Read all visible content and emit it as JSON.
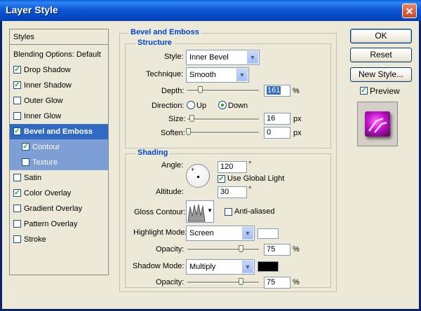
{
  "window": {
    "title": "Layer Style",
    "close_glyph": "✕"
  },
  "styles_list": {
    "header": "Styles",
    "items": [
      {
        "label": "Blending Options: Default",
        "checkbox": false,
        "checked": false
      },
      {
        "label": "Drop Shadow",
        "checkbox": true,
        "checked": true
      },
      {
        "label": "Inner Shadow",
        "checkbox": true,
        "checked": true
      },
      {
        "label": "Outer Glow",
        "checkbox": true,
        "checked": false
      },
      {
        "label": "Inner Glow",
        "checkbox": true,
        "checked": false
      },
      {
        "label": "Bevel and Emboss",
        "checkbox": true,
        "checked": true,
        "selected": true
      },
      {
        "label": "Contour",
        "checkbox": true,
        "checked": true,
        "sub": true
      },
      {
        "label": "Texture",
        "checkbox": true,
        "checked": false,
        "sub": true
      },
      {
        "label": "Satin",
        "checkbox": true,
        "checked": false
      },
      {
        "label": "Color Overlay",
        "checkbox": true,
        "checked": true
      },
      {
        "label": "Gradient Overlay",
        "checkbox": true,
        "checked": false
      },
      {
        "label": "Pattern Overlay",
        "checkbox": true,
        "checked": false
      },
      {
        "label": "Stroke",
        "checkbox": true,
        "checked": false
      }
    ]
  },
  "bevel": {
    "group_title": "Bevel and Emboss",
    "structure_title": "Structure",
    "style_label": "Style:",
    "style_value": "Inner Bevel",
    "technique_label": "Technique:",
    "technique_value": "Smooth",
    "depth_label": "Depth:",
    "depth_value": "161",
    "percent": "%",
    "direction_label": "Direction:",
    "direction_up": "Up",
    "direction_down": "Down",
    "size_label": "Size:",
    "size_value": "16",
    "soften_label": "Soften:",
    "soften_value": "0",
    "px": "px"
  },
  "shading": {
    "title": "Shading",
    "angle_label": "Angle:",
    "angle_value": "120",
    "degree": "°",
    "global_light_label": "Use Global Light",
    "altitude_label": "Altitude:",
    "altitude_value": "30",
    "gloss_label": "Gloss Contour:",
    "antialiased_label": "Anti-aliased",
    "highlight_mode_label": "Highlight Mode:",
    "highlight_mode_value": "Screen",
    "highlight_color": "#ffffff",
    "highlight_opacity_label": "Opacity:",
    "highlight_opacity_value": "75",
    "shadow_mode_label": "Shadow Mode:",
    "shadow_mode_value": "Multiply",
    "shadow_color": "#000000",
    "shadow_opacity_label": "Opacity:",
    "shadow_opacity_value": "75",
    "percent": "%"
  },
  "buttons": {
    "ok": "OK",
    "reset": "Reset",
    "new_style": "New Style...",
    "preview_label": "Preview"
  }
}
